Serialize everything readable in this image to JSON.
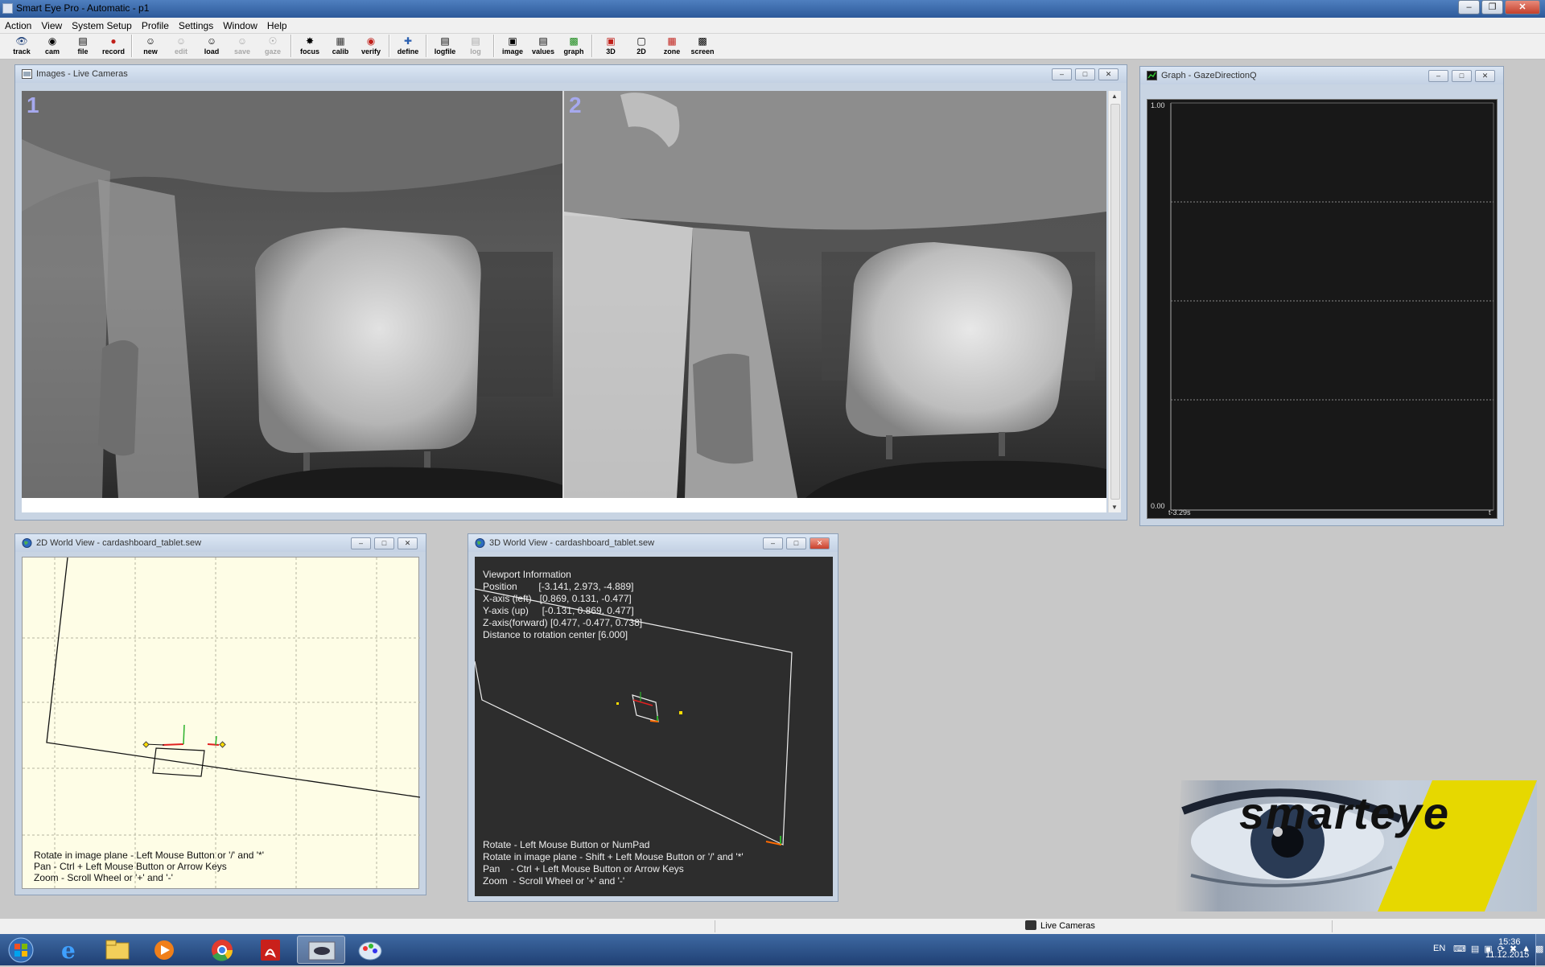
{
  "app": {
    "title": "Smart Eye Pro - Automatic - p1"
  },
  "menu": [
    "Action",
    "View",
    "System Setup",
    "Profile",
    "Settings",
    "Window",
    "Help"
  ],
  "toolbar": {
    "groups": [
      [
        {
          "label": "track",
          "icon": "eye-icon",
          "enabled": true
        },
        {
          "label": "cam",
          "icon": "camera-icon",
          "enabled": true
        },
        {
          "label": "file",
          "icon": "file-icon",
          "enabled": true
        },
        {
          "label": "record",
          "icon": "record-icon",
          "enabled": true
        }
      ],
      [
        {
          "label": "new",
          "icon": "new-face-icon",
          "enabled": true
        },
        {
          "label": "edit",
          "icon": "edit-face-icon",
          "enabled": false
        },
        {
          "label": "load",
          "icon": "load-face-icon",
          "enabled": true
        },
        {
          "label": "save",
          "icon": "save-face-icon",
          "enabled": false
        },
        {
          "label": "gaze",
          "icon": "gaze-icon",
          "enabled": false
        }
      ],
      [
        {
          "label": "focus",
          "icon": "focus-icon",
          "enabled": true
        },
        {
          "label": "calib",
          "icon": "calib-icon",
          "enabled": true
        },
        {
          "label": "verify",
          "icon": "verify-icon",
          "enabled": true
        }
      ],
      [
        {
          "label": "define",
          "icon": "define-icon",
          "enabled": true
        }
      ],
      [
        {
          "label": "logfile",
          "icon": "logfile-icon",
          "enabled": true
        },
        {
          "label": "log",
          "icon": "log-icon",
          "enabled": false
        }
      ],
      [
        {
          "label": "image",
          "icon": "image-icon",
          "enabled": true
        },
        {
          "label": "values",
          "icon": "values-icon",
          "enabled": true
        },
        {
          "label": "graph",
          "icon": "graph-icon",
          "enabled": true
        }
      ],
      [
        {
          "label": "3D",
          "icon": "3d-icon",
          "enabled": true
        },
        {
          "label": "2D",
          "icon": "2d-icon",
          "enabled": true
        },
        {
          "label": "zone",
          "icon": "zone-icon",
          "enabled": true
        },
        {
          "label": "screen",
          "icon": "screen-icon",
          "enabled": true
        }
      ]
    ]
  },
  "images_window": {
    "title": "Images - Live Cameras",
    "cameras": [
      "1",
      "2"
    ]
  },
  "graph_window": {
    "title": "Graph - GazeDirectionQ",
    "y_max": "1.00",
    "y_min": "0.00",
    "x_label": "t-3.29s",
    "x_end": "t"
  },
  "world2d_window": {
    "title": "2D World View - cardashboard_tablet.sew",
    "help": [
      "Rotate in image plane - Left Mouse Button or '/' and '*'",
      "Pan - Ctrl + Left Mouse Button or Arrow Keys",
      "Zoom - Scroll Wheel or '+' and '-'"
    ]
  },
  "world3d_window": {
    "title": "3D World View - cardashboard_tablet.sew",
    "viewport": [
      "Viewport Information",
      "Position        [-3.141, 2.973, -4.889]",
      "X-axis (left)   [0.869, 0.131, -0.477]",
      "Y-axis (up)     [-0.131, 0.869, 0.477]",
      "Z-axis(forward) [0.477, -0.477, 0.738]",
      "Distance to rotation center [6.000]"
    ],
    "help": [
      "Rotate - Left Mouse Button or NumPad",
      "Rotate in image plane - Shift + Left Mouse Button or '/' and '*'",
      "Pan    - Ctrl + Left Mouse Button or Arrow Keys",
      "Zoom  - Scroll Wheel or '+' and '-'"
    ]
  },
  "logo": {
    "text": "smarteye"
  },
  "statusbar": {
    "text": "Live Cameras"
  },
  "taskbar": {
    "apps": [
      "start-button",
      "internet-explorer-icon",
      "file-explorer-icon",
      "media-player-icon",
      "chrome-icon",
      "acrobat-icon",
      "smart-eye-pro-icon",
      "paint-icon"
    ],
    "language": "EN",
    "time": "15:36",
    "date": "11.12.2015"
  }
}
